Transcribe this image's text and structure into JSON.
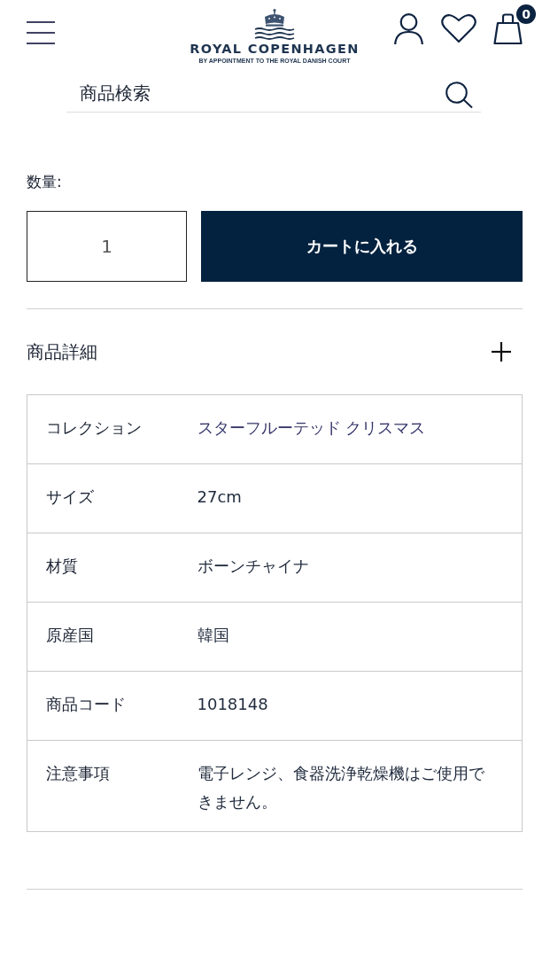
{
  "header": {
    "brand": {
      "name": "ROYAL COPENHAGEN",
      "tagline": "BY APPOINTMENT TO THE ROYAL DANISH COURT"
    },
    "cart_count": "0"
  },
  "search": {
    "placeholder": "商品検索"
  },
  "quantity": {
    "label": "数量:",
    "value": "1"
  },
  "add_to_cart": {
    "label": "カートに入れる"
  },
  "details": {
    "title": "商品詳細",
    "rows": [
      {
        "label": "コレクション",
        "value": "スターフルーテッド クリスマス",
        "kind": "link"
      },
      {
        "label": "サイズ",
        "value": "27cm",
        "kind": "text"
      },
      {
        "label": "材質",
        "value": "ボーンチャイナ",
        "kind": "text"
      },
      {
        "label": "原産国",
        "value": "韓国",
        "kind": "text"
      },
      {
        "label": "商品コード",
        "value": "1018148",
        "kind": "text"
      },
      {
        "label": "注意事項",
        "value": "電子レンジ、食器洗浄乾燥機はご使用できません。",
        "kind": "text"
      }
    ]
  }
}
